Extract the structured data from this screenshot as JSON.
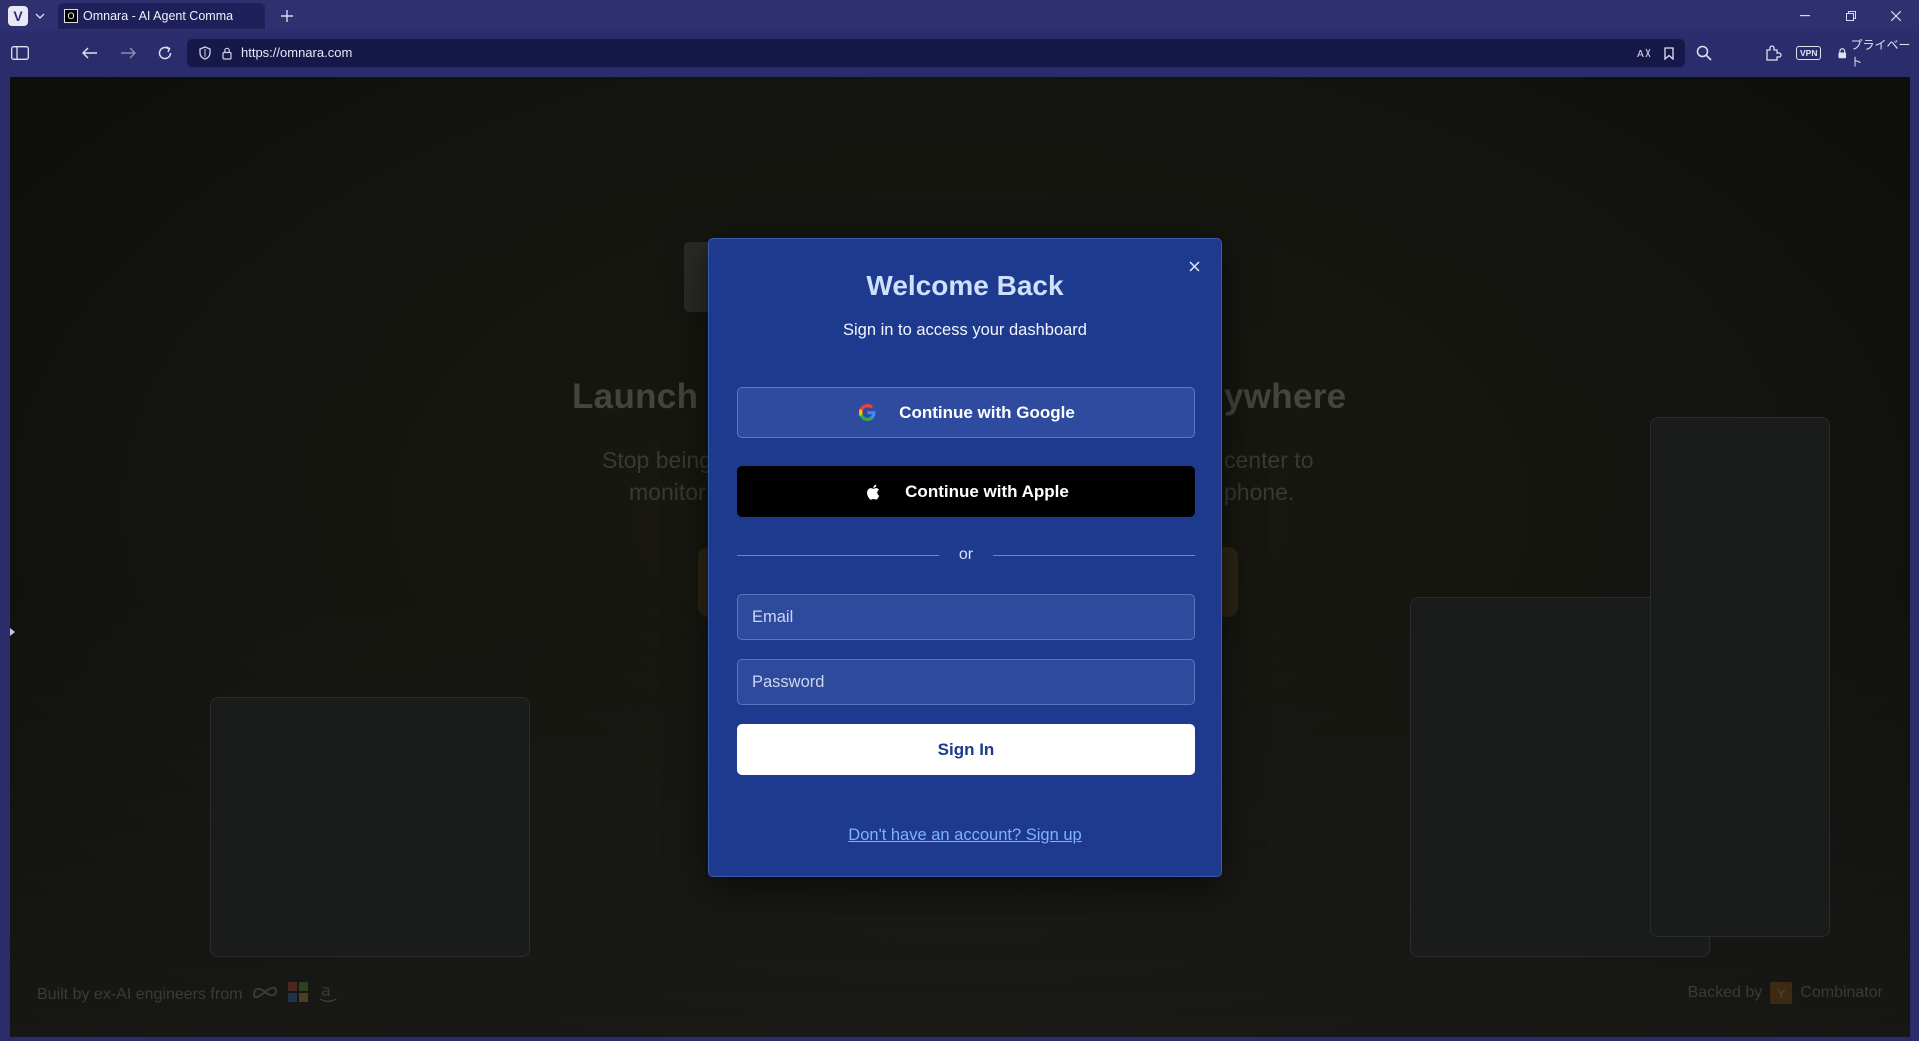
{
  "browser": {
    "tab_title": "Omnara - AI Agent Comma",
    "favicon_text": "O",
    "url": "https://omnara.com",
    "private_label": "プライベート",
    "vpn_label": "VPN",
    "icons": {
      "logo": "vivaldi-icon",
      "new_tab": "plus-icon",
      "back": "arrow-left-icon",
      "forward": "arrow-right-icon",
      "reload": "reload-icon",
      "shield": "shield-icon",
      "lock": "lock-icon",
      "translate": "translate-icon",
      "bookmark": "bookmark-icon",
      "search": "search-icon",
      "extensions": "puzzle-icon"
    }
  },
  "background": {
    "headline_left": "Launch",
    "headline_right": "ywhere",
    "sub_line1_left": "Stop being",
    "sub_line1_right": "center to",
    "sub_line2_left": "monitor",
    "sub_line2_right": "phone.",
    "footer_left": "Built by ex-AI engineers from",
    "footer_right_prefix": "Backed by",
    "footer_right_brand": "Combinator",
    "yc_letter": "Y"
  },
  "modal": {
    "title": "Welcome Back",
    "subtitle": "Sign in to access your dashboard",
    "google_button": "Continue with Google",
    "apple_button": "Continue with Apple",
    "divider_text": "or",
    "email_placeholder": "Email",
    "password_placeholder": "Password",
    "signin_button": "Sign In",
    "signup_link": "Don't have an account? Sign up"
  },
  "colors": {
    "modal_bg": "#1d3a8e",
    "title": "#cfe0ff",
    "link": "#7fb1ff",
    "chrome": "#2f3070"
  }
}
